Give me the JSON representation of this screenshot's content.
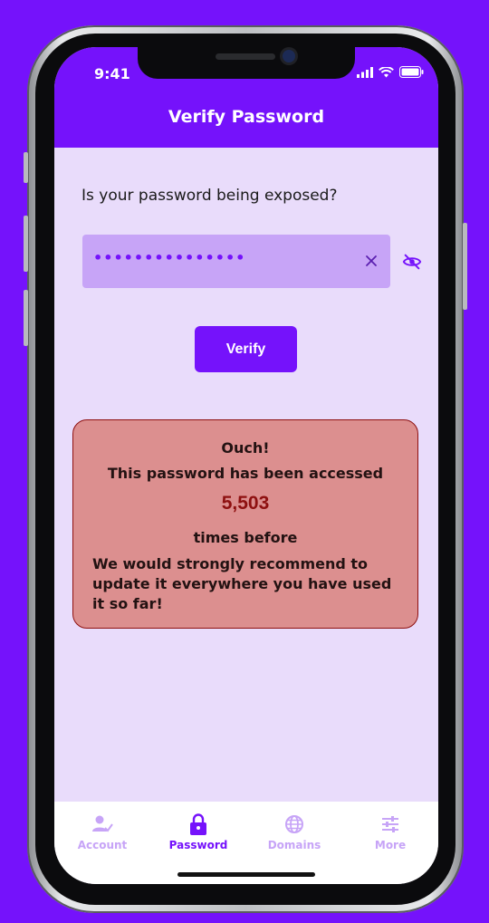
{
  "status": {
    "time": "9:41"
  },
  "header": {
    "title": "Verify Password"
  },
  "form": {
    "question": "Is your password being exposed?",
    "password_masked": "•••••••••••••••",
    "verify_label": "Verify"
  },
  "alert": {
    "line1": "Ouch!",
    "line2": "This password has been accessed",
    "count": "5,503",
    "line3": "times before",
    "line4": "We would strongly recommend to update it everywhere you have used it so far!"
  },
  "tabs": [
    {
      "label": "Account",
      "icon": "account-check-icon",
      "active": false
    },
    {
      "label": "Password",
      "icon": "lock-icon",
      "active": true
    },
    {
      "label": "Domains",
      "icon": "globe-icon",
      "active": false
    },
    {
      "label": "More",
      "icon": "sliders-icon",
      "active": false
    }
  ],
  "colors": {
    "primary": "#7512fb",
    "field": "#c7a4f7",
    "background": "#e9dcfb",
    "alert_bg": "#dc8f8f",
    "alert_accent": "#8e1010"
  }
}
